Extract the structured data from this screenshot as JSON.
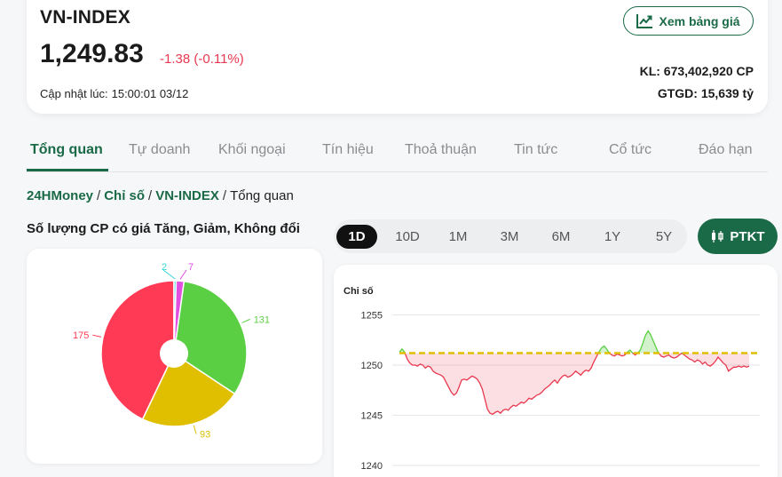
{
  "header": {
    "index_name": "VN-INDEX",
    "price": "1,249.83",
    "change": "-1.38 (-0.11%)",
    "updated_label": "Cập nhật lúc:",
    "updated_time": "15:00:01 03/12",
    "view_price_button": "Xem bảng giá",
    "kl": "KL: 673,402,920 CP",
    "gtgd": "GTGD: 15,639 tỷ"
  },
  "tabs": [
    "Tổng quan",
    "Tự doanh",
    "Khối ngoại",
    "Tín hiệu",
    "Thoả thuận",
    "Tin tức",
    "Cổ tức",
    "Đáo hạn"
  ],
  "active_tab": 0,
  "breadcrumb": {
    "site": "24HMoney",
    "section": "Chỉ số",
    "index": "VN-INDEX",
    "current": "Tổng quan",
    "separator": "/"
  },
  "pie_title": "Số lượng CP có giá Tăng, Giảm, Không đổi",
  "ranges": [
    "1D",
    "10D",
    "1M",
    "3M",
    "6M",
    "1Y",
    "5Y"
  ],
  "active_range": "1D",
  "ptkt_button": "PTKT",
  "colors": {
    "brand": "#1a6a47",
    "down": "#e8384f",
    "up": "#5bcf44",
    "ref": "#e0be00",
    "ceiling": "#e04fe0",
    "floor": "#38d6d6"
  },
  "chart_data": [
    {
      "type": "pie",
      "donut": true,
      "slices": [
        {
          "value": 131,
          "color": "#5bcf44"
        },
        {
          "value": 93,
          "color": "#e0be00"
        },
        {
          "value": 175,
          "color": "#ff3a55"
        },
        {
          "value": 2,
          "color": "#38d6d6"
        },
        {
          "value": 7,
          "color": "#e04fe0"
        }
      ]
    },
    {
      "type": "area",
      "ylabel": "Chi số",
      "yticks": [
        1255,
        1250,
        1245,
        1240
      ],
      "ylim": [
        1240,
        1256.5
      ],
      "reference": 1251.2,
      "grid": true,
      "values": [
        1251.3,
        1251.6,
        1251.3,
        1250.6,
        1250.2,
        1250.0,
        1250.0,
        1249.9,
        1250.1,
        1250.0,
        1249.7,
        1249.9,
        1249.8,
        1249.4,
        1249.2,
        1249.1,
        1249.0,
        1248.8,
        1248.3,
        1247.8,
        1247.3,
        1247.0,
        1247.2,
        1247.8,
        1248.5,
        1248.6,
        1248.5,
        1248.7,
        1248.9,
        1248.8,
        1248.6,
        1248.2,
        1247.6,
        1246.6,
        1245.6,
        1245.2,
        1245.1,
        1245.3,
        1245.4,
        1245.2,
        1245.5,
        1245.6,
        1245.5,
        1245.8,
        1246.0,
        1245.9,
        1246.1,
        1246.3,
        1246.2,
        1246.4,
        1246.7,
        1246.6,
        1246.8,
        1247.0,
        1247.1,
        1247.3,
        1247.6,
        1247.8,
        1248.0,
        1248.3,
        1248.5,
        1248.2,
        1248.6,
        1248.9,
        1249.0,
        1248.8,
        1248.9,
        1249.1,
        1249.4,
        1249.2,
        1249.0,
        1249.3,
        1249.5,
        1249.4,
        1249.7,
        1250.3,
        1250.8,
        1251.3,
        1251.7,
        1251.9,
        1251.6,
        1251.2,
        1251.0,
        1250.9,
        1251.1,
        1251.0,
        1250.9,
        1251.0,
        1251.3,
        1251.5,
        1251.2,
        1251.0,
        1251.2,
        1251.5,
        1252.2,
        1253.0,
        1253.4,
        1253.0,
        1252.4,
        1251.8,
        1251.2,
        1250.9,
        1250.8,
        1250.9,
        1251.0,
        1250.8,
        1250.7,
        1250.8,
        1251.0,
        1251.2,
        1251.0,
        1250.8,
        1250.6,
        1250.5,
        1250.3,
        1250.5,
        1250.4,
        1250.1,
        1250.3,
        1250.0,
        1249.9,
        1250.1,
        1250.4,
        1250.8,
        1250.5,
        1250.2,
        1250.0,
        1249.4,
        1249.6,
        1249.8,
        1249.8,
        1249.9,
        1249.8,
        1249.9,
        1249.8,
        1249.9
      ]
    }
  ]
}
